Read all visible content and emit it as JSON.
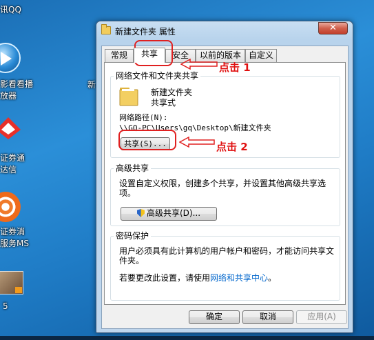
{
  "desktop": {
    "qq_label": "讯QQ",
    "player_label_1": "影看看播",
    "player_label_2": "放器",
    "stock_label_1": "证券通",
    "stock_label_2": "达信",
    "weibo_label_1": "证券消",
    "weibo_label_2": "服务MS",
    "video_label": "5",
    "right_fragment": "新"
  },
  "window": {
    "title": "新建文件夹 属性",
    "close_glyph": "✕",
    "tabs": [
      "常规",
      "共享",
      "安全",
      "以前的版本",
      "自定义"
    ],
    "active_tab": "共享",
    "sharing_group": {
      "title": "网络文件和文件夹共享",
      "folder_name": "新建文件夹",
      "state": "共享式",
      "path_label": "网络路径(N):",
      "path_value": "\\\\GQ-PC\\Users\\gq\\Desktop\\新建文件夹",
      "share_button": "共享(S)..."
    },
    "advanced_group": {
      "title": "高级共享",
      "description": "设置自定义权限，创建多个共享，并设置其他高级共享选项。",
      "button": "高级共享(D)..."
    },
    "password_group": {
      "title": "密码保护",
      "description": "用户必须具有此计算机的用户帐户和密码，才能访问共享文件夹。",
      "change_prefix": "若要更改此设置，请使用",
      "change_link": "网络和共享中心",
      "change_suffix": "。"
    },
    "buttons": {
      "ok": "确定",
      "cancel": "取消",
      "apply": "应用(A)"
    }
  },
  "annotations": {
    "step1": "点击 1",
    "step2": "点击 2",
    "color": "#e02020"
  }
}
